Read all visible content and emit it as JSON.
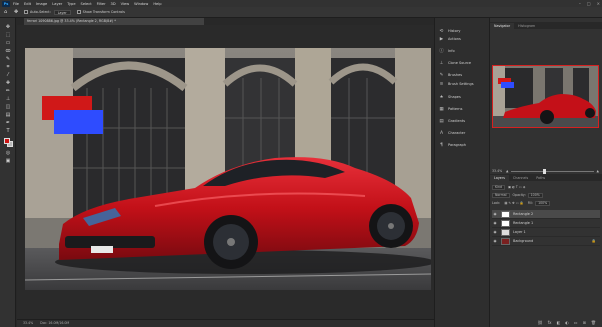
{
  "menu": {
    "logo": "Ps",
    "items": [
      "File",
      "Edit",
      "Image",
      "Layer",
      "Type",
      "Select",
      "Filter",
      "3D",
      "View",
      "Window",
      "Help"
    ],
    "window_controls": [
      "–",
      "□",
      "×"
    ]
  },
  "options_bar": {
    "auto_select_label": "Auto-Select:",
    "auto_select_value": "Layer",
    "transform_label": "Show Transform Controls"
  },
  "document": {
    "tab_title": "ferrari 1090886.jpg @ 33.4% (Rectangle 2, RGB/8#) *"
  },
  "status_bar": {
    "zoom": "33.4%",
    "doc_size": "Doc: 16.0M/16.0M"
  },
  "dock": {
    "items": [
      {
        "label": "History",
        "icon": "history-icon"
      },
      {
        "label": "Actions",
        "icon": "actions-icon"
      },
      {
        "label": "Info",
        "icon": "info-icon"
      },
      {
        "label": "Clone Source",
        "icon": "clone-source-icon"
      },
      {
        "label": "Brushes",
        "icon": "brushes-icon"
      },
      {
        "label": "Brush Settings",
        "icon": "brush-settings-icon"
      },
      {
        "label": "Shapes",
        "icon": "shapes-icon"
      },
      {
        "label": "Patterns",
        "icon": "patterns-icon"
      },
      {
        "label": "Gradients",
        "icon": "gradients-icon"
      },
      {
        "label": "Character",
        "icon": "character-icon"
      },
      {
        "label": "Paragraph",
        "icon": "paragraph-icon"
      }
    ]
  },
  "navigator": {
    "tabs": [
      "Navigator",
      "Histogram"
    ],
    "zoom": "33.4%"
  },
  "layers": {
    "tabs": [
      "Layers",
      "Channels",
      "Paths"
    ],
    "kind_label": "Kind",
    "blend_mode": "Normal",
    "opacity_label": "Opacity:",
    "opacity_value": "100%",
    "lock_label": "Lock:",
    "fill_label": "Fill:",
    "fill_value": "100%",
    "rows": [
      {
        "name": "Rectangle 2",
        "selected": true
      },
      {
        "name": "Rectangle 1",
        "selected": false
      },
      {
        "name": "Layer 1",
        "selected": false
      },
      {
        "name": "Background",
        "selected": false
      }
    ]
  },
  "colors": {
    "foreground": "#cc1414",
    "background": "#b9b9b9",
    "rect1": "#d01818",
    "rect2": "#2e4cff",
    "car": "#c41018"
  }
}
